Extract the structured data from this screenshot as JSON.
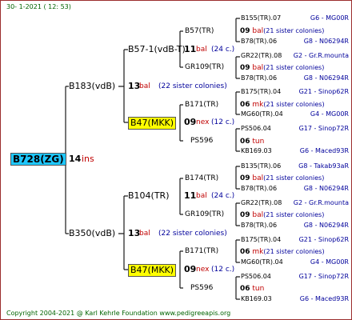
{
  "header": {
    "date": "30-   1-2021  ( 12: 53)"
  },
  "footer": {
    "copyright": "Copyright 2004-2021 @ Karl Kehrle Foundation    www.pedigreeapis.org"
  },
  "colors": {
    "root_bg": "#1ec7ff",
    "highlight_bg": "#ffff00",
    "line": "#1a1a1a",
    "red": "#c00000",
    "blue": "#00009b"
  },
  "root": {
    "name": "B728(ZG)",
    "num": "14",
    "tag": "ins"
  },
  "gen1": {
    "top": {
      "name": "B183(vdB)",
      "num": "13",
      "tag": "bal",
      "note": "(22 sister colonies)"
    },
    "bottom": {
      "name": "B350(vdB)",
      "num": "13",
      "tag": "bal",
      "note": "(22 sister colonies)"
    }
  },
  "gen2": {
    "a": {
      "name": "B57-1(vdB-T)",
      "num": "11",
      "tag": "bal",
      "note": "(24 c.)"
    },
    "b": {
      "name": "B47(MKK)",
      "num": "09",
      "tag": "nex",
      "note": "(12 c.)"
    },
    "c": {
      "name": "B104(TR)",
      "num": "11",
      "tag": "bal",
      "note": "(24 c.)"
    },
    "d": {
      "name": "B47(MKK)",
      "num": "09",
      "tag": "nex",
      "note": "(12 c.)"
    }
  },
  "gen3": {
    "a1": {
      "name": "B57(TR)",
      "num": "09",
      "tag": "bal",
      "note": "(21 sister colonies)"
    },
    "a2": {
      "name": "GR109(TR)",
      "num": "09",
      "tag": "bal",
      "note": "(21 sister colonies)"
    },
    "b1": {
      "name": "B171(TR)",
      "num": "06",
      "tag": "mk",
      "note": "(21 sister colonies)"
    },
    "b2": {
      "name": "PS596",
      "num": "06",
      "tag": "tun"
    },
    "c1": {
      "name": "B174(TR)",
      "num": "09",
      "tag": "bal",
      "note": "(21 sister colonies)"
    },
    "c2": {
      "name": "GR109(TR)",
      "num": "09",
      "tag": "bal",
      "note": "(21 sister colonies)"
    },
    "d1": {
      "name": "B171(TR)",
      "num": "06",
      "tag": "mk",
      "note": "(21 sister colonies)"
    },
    "d2": {
      "name": "PS596",
      "num": "06",
      "tag": "tun"
    }
  },
  "gen4": [
    {
      "name": "B155(TR).07",
      "group": "G6 - MG00R"
    },
    {
      "name": "B78(TR).06",
      "group": "G8 - N06294R"
    },
    {
      "name": "GR22(TR).08",
      "group": "G2 - Gr.R.mounta"
    },
    {
      "name": "B78(TR).06",
      "group": "G8 - N06294R"
    },
    {
      "name": "B175(TR).04",
      "group": "G21 - Sinop62R"
    },
    {
      "name": "MG60(TR).04",
      "group": "G4 - MG00R"
    },
    {
      "name": "PS506.04",
      "group": "G17 - Sinop72R"
    },
    {
      "name": "KB169.03",
      "group": "G6 - Maced93R"
    },
    {
      "name": "B135(TR).06",
      "group": "G8 - Takab93aR"
    },
    {
      "name": "B78(TR).06",
      "group": "G8 - N06294R"
    },
    {
      "name": "GR22(TR).08",
      "group": "G2 - Gr.R.mounta"
    },
    {
      "name": "B78(TR).06",
      "group": "G8 - N06294R"
    },
    {
      "name": "B175(TR).04",
      "group": "G21 - Sinop62R"
    },
    {
      "name": "MG60(TR).04",
      "group": "G4 - MG00R"
    },
    {
      "name": "PS506.04",
      "group": "G17 - Sinop72R"
    },
    {
      "name": "KB169.03",
      "group": "G6 - Maced93R"
    }
  ]
}
